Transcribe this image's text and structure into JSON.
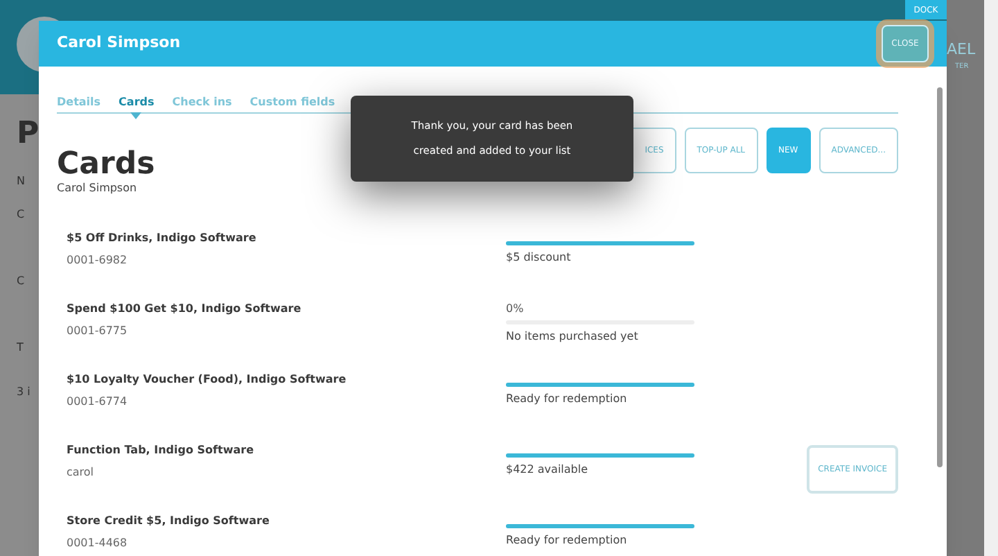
{
  "background": {
    "heading": "P",
    "column_header": "N",
    "rows": [
      "C",
      "C",
      "T"
    ],
    "footer": "3 i",
    "user_name": "AEL",
    "user_role": "TER"
  },
  "dock_tab": "DOCK",
  "window": {
    "title": "Carol Simpson",
    "close": "CLOSE"
  },
  "tabs": [
    {
      "label": "Details",
      "selected": false
    },
    {
      "label": "Cards",
      "selected": true
    },
    {
      "label": "Check ins",
      "selected": false
    },
    {
      "label": "Custom fields",
      "selected": false
    }
  ],
  "heading": "Cards",
  "subheading": "Carol Simpson",
  "toolbar": [
    {
      "label": "ICES",
      "primary": false
    },
    {
      "label": "TOP-UP ALL",
      "primary": false
    },
    {
      "label": "NEW",
      "primary": true
    },
    {
      "label": "ADVANCED...",
      "primary": false
    }
  ],
  "toast": "Thank you, your card has been created and added to your list",
  "cards": [
    {
      "name": "$5 Off Drinks, Indigo Software",
      "number": "0001-6982",
      "level": 1,
      "status": "$5 discount"
    },
    {
      "name": "Spend $100 Get $10, Indigo Software",
      "number": "0001-6775",
      "percent": "0%",
      "level": 0,
      "status": "No items purchased yet"
    },
    {
      "name": "$10 Loyalty Voucher (Food), Indigo Software",
      "number": "0001-6774",
      "level": 1,
      "status": "Ready for redemption"
    },
    {
      "name": "Function Tab, Indigo Software",
      "number": "carol",
      "level": 1,
      "status": "$422 available",
      "action": "CREATE INVOICE"
    },
    {
      "name": "Store Credit $5, Indigo Software",
      "number": "0001-4468",
      "level": 1,
      "status": "Ready for redemption"
    }
  ]
}
